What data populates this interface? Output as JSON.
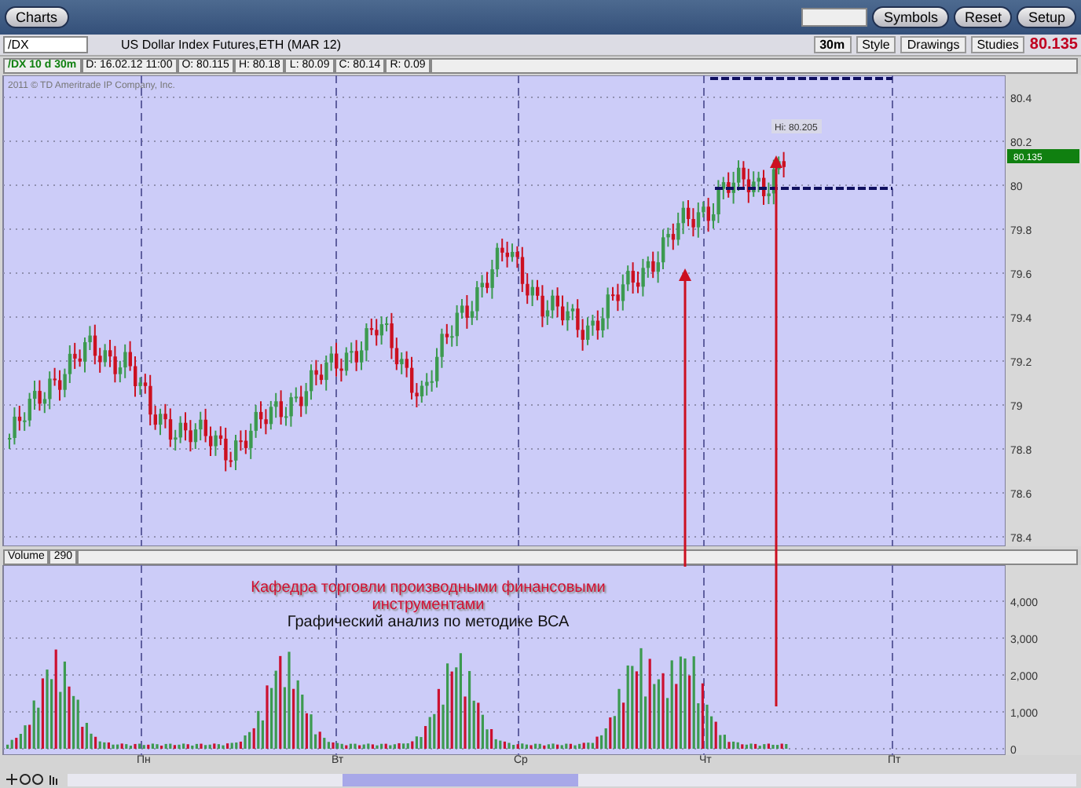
{
  "window": {
    "title": "Charts"
  },
  "top_buttons": [
    "Symbols",
    "Reset",
    "Setup"
  ],
  "toolbar": {
    "symbol": "/DX",
    "description": "US Dollar Index Futures,ETH (MAR 12)",
    "interval": "30m",
    "buttons": [
      "Style",
      "Drawings",
      "Studies"
    ],
    "last_price": "80.135"
  },
  "info": [
    "/DX 10 d 30m",
    "D: 16.02.12 11:00",
    "O: 80.115",
    "H: 80.18",
    "L: 80.09",
    "C: 80.14",
    "R: 0.09"
  ],
  "price_pane": {
    "copyright": "2011 © TD Ameritrade IP Company, Inc.",
    "y_labels": [
      "80.4",
      "80.2",
      "80",
      "79.8",
      "79.6",
      "79.4",
      "79.2",
      "79",
      "78.8",
      "78.6",
      "78.4"
    ],
    "current_price": "80.135",
    "hi_label": "Hi: 80.205"
  },
  "volume_pane": {
    "title": "Volume",
    "value": "290",
    "y_labels": [
      "4,000",
      "3,000",
      "2,000",
      "1,000",
      "0"
    ]
  },
  "x_labels": [
    "Пн",
    "Вт",
    "Ср",
    "Чт",
    "Пт"
  ],
  "annotations": {
    "title": "Кафедра торговли производными финансовыми инструментами",
    "subtitle": "Графический анализ по методике ВСА"
  }
}
